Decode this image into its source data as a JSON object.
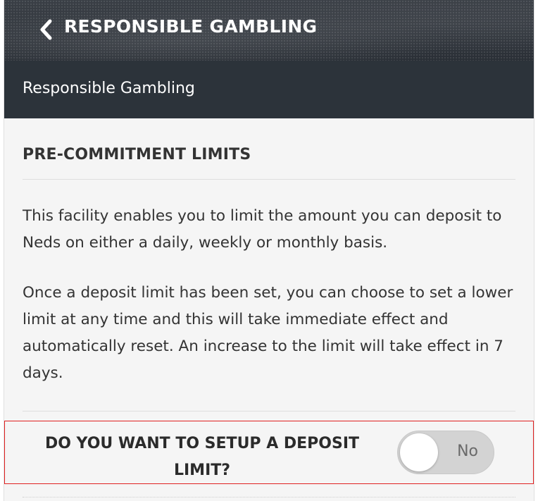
{
  "header": {
    "title": "RESPONSIBLE GAMBLING",
    "back_icon": "chevron-left-icon"
  },
  "subheader": {
    "title": "Responsible Gambling"
  },
  "section": {
    "title": "PRE-COMMITMENT LIMITS",
    "paragraph1": "This facility enables you to limit the amount you can deposit to Neds on either a daily, weekly or monthly basis.",
    "paragraph2": "Once a deposit limit has been set, you can choose to set a lower limit at any time and this will take immediate effect and automatically reset. An increase to the limit will take effect in 7 days."
  },
  "deposit_limit": {
    "question": "DO YOU WANT TO SETUP A DEPOSIT LIMIT?",
    "toggle_label": "No",
    "toggle_on": false
  },
  "colors": {
    "header_bg": "#2c3138",
    "highlight_border": "#e02020",
    "toggle_bg": "#d3d3d3"
  }
}
